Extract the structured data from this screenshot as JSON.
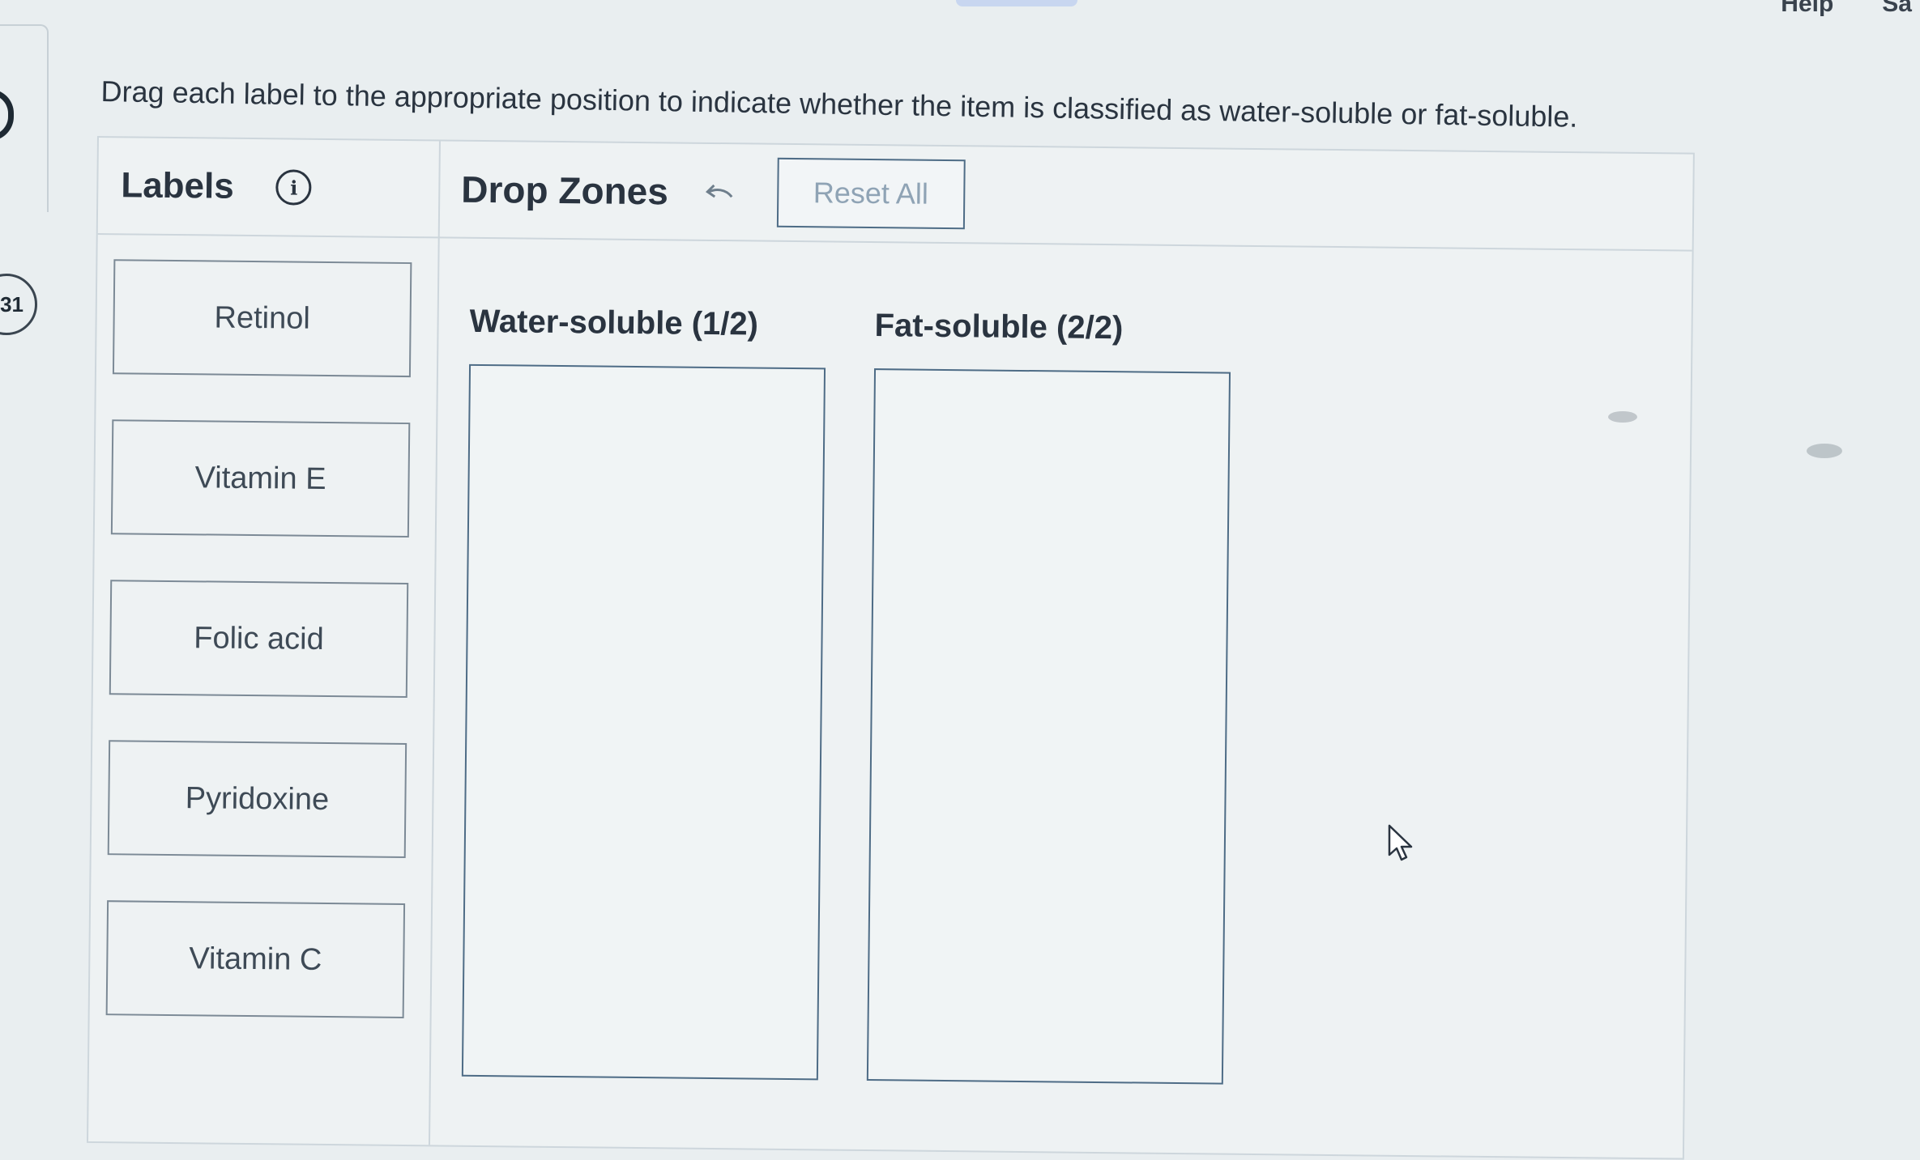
{
  "top_nav": {
    "help": "Help",
    "save": "Sa"
  },
  "question": {
    "number": "31",
    "instruction": "Drag each label to the appropriate position to indicate whether the item is classified as water-soluble or fat-soluble."
  },
  "labels_panel": {
    "title": "Labels",
    "info_icon": "info-icon",
    "items": [
      {
        "label": "Retinol"
      },
      {
        "label": "Vitamin E"
      },
      {
        "label": "Folic acid"
      },
      {
        "label": "Pyridoxine"
      },
      {
        "label": "Vitamin C"
      }
    ]
  },
  "drop_panel": {
    "title": "Drop Zones",
    "back_icon": "arrow-left-icon",
    "reset_label": "Reset All",
    "zones": [
      {
        "title": "Water-soluble (1/2)"
      },
      {
        "title": "Fat-soluble (2/2)"
      }
    ]
  },
  "colors": {
    "accent_border": "#4e6c86",
    "reset_text": "#8fa3b5",
    "text_dark": "#2a3440"
  }
}
